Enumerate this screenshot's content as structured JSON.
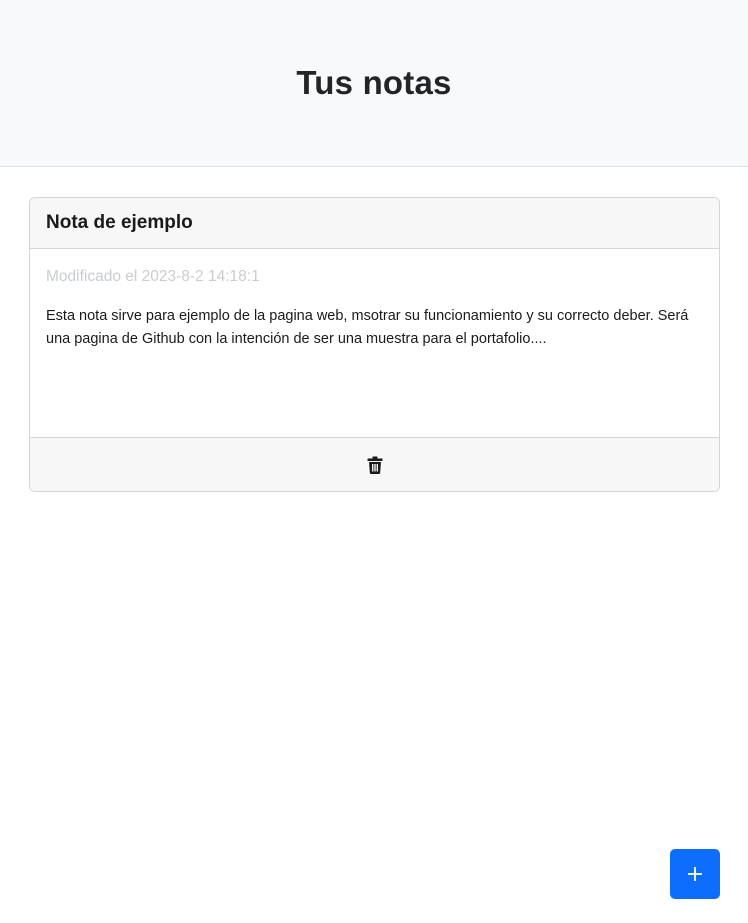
{
  "header": {
    "title": "Tus notas"
  },
  "notes": [
    {
      "title": "Nota de ejemplo",
      "modified": "Modificado el 2023-8-2 14:18:1",
      "body": "Esta nota sirve para ejemplo de la pagina web, msotrar su funcionamiento y su correcto deber. Será una pagina de Github con la intención de ser una muestra para el portafolio....",
      "delete_icon": "trash-icon"
    }
  ],
  "add_button": {
    "icon": "plus-icon"
  },
  "colors": {
    "header_bg": "#f8f9fa",
    "card_header_bg": "#f7f7f7",
    "accent": "#0d6efd",
    "muted_text": "#c9ccd0"
  }
}
